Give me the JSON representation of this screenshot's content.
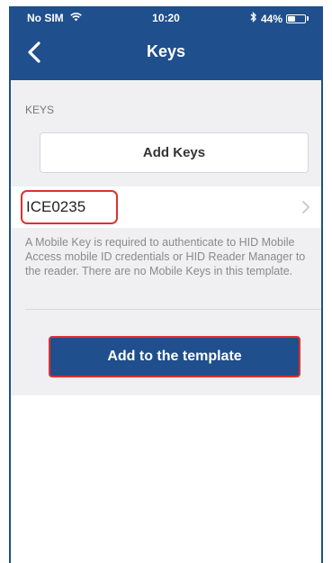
{
  "status_bar": {
    "carrier": "No SIM",
    "time": "10:20",
    "battery": "44%",
    "battery_level": 0.44,
    "icons": {
      "wifi": "wifi-icon",
      "bluetooth": "bluetooth-icon",
      "battery": "battery-icon"
    }
  },
  "nav": {
    "title": "Keys",
    "back_icon": "chevron-left-icon"
  },
  "keys_section": {
    "header": "KEYS",
    "add_button": "Add Keys",
    "items": [
      {
        "label": "ICE0235",
        "chevron_icon": "chevron-right-icon"
      }
    ],
    "description": "A Mobile Key is required to authenticate to HID Mobile Access mobile ID credentials or HID Reader Manager to the reader. There are no Mobile Keys in this template."
  },
  "actions": {
    "add_to_template": "Add to the template"
  },
  "colors": {
    "brand_blue": "#1f4f8c",
    "highlight_red": "#e03030",
    "background_gray": "#f0f0f3"
  }
}
